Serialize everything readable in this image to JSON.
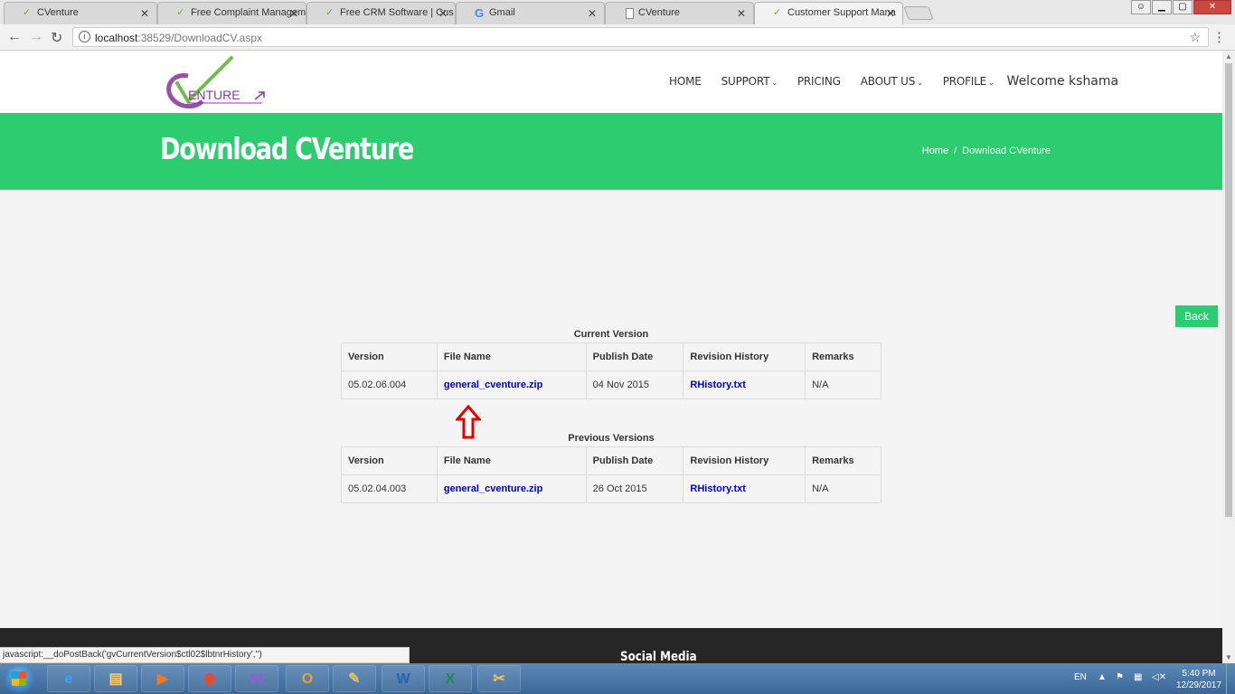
{
  "browser": {
    "tabs": [
      {
        "title": "CVenture",
        "icon": "cventure-check-icon"
      },
      {
        "title": "Free Complaint Managem",
        "icon": "cventure-check-icon"
      },
      {
        "title": "Free CRM Software | Cus",
        "icon": "cventure-check-icon"
      },
      {
        "title": "Gmail",
        "icon": "google-g-icon"
      },
      {
        "title": "CVenture",
        "icon": "page-icon"
      },
      {
        "title": "Customer Support Mana",
        "icon": "cventure-check-icon"
      }
    ],
    "url_host": "localhost",
    "url_path": ":38529/DownloadCV.aspx"
  },
  "header": {
    "logo_text": "ENTURE",
    "nav": {
      "home": "HOME",
      "support": "SUPPORT",
      "pricing": "PRICING",
      "about": "ABOUT US",
      "profile": "PROFILE",
      "welcome": "Welcome kshama"
    }
  },
  "hero": {
    "title": "Download CVenture",
    "breadcrumb_home": "Home",
    "breadcrumb_sep": "/",
    "breadcrumb_current": "Download CVenture"
  },
  "back_button": "Back",
  "current": {
    "caption": "Current Version",
    "headers": [
      "Version",
      "File Name",
      "Publish Date",
      "Revision History",
      "Remarks"
    ],
    "row": {
      "version": "05.02.06.004",
      "file": "general_cventure.zip",
      "date": "04 Nov 2015",
      "history": "RHistory.txt",
      "remarks": "N/A"
    }
  },
  "previous": {
    "caption": "Previous Versions",
    "headers": [
      "Version",
      "File Name",
      "Publish Date",
      "Revision History",
      "Remarks"
    ],
    "row": {
      "version": "05.02.04.003",
      "file": "general_cventure.zip",
      "date": "26 Oct 2015",
      "history": "RHistory.txt",
      "remarks": "N/A"
    }
  },
  "footer": {
    "social": "Social Media"
  },
  "status_text": "javascript:__doPostBack('gvCurrentVersion$ctl02$lbtnrHistory','')",
  "taskbar": {
    "lang": "EN",
    "time": "5:40 PM",
    "date": "12/29/2017"
  },
  "colors": {
    "accent": "#2ecc71",
    "link": "#0000c8",
    "footer": "#262626",
    "annotation_arrow": "#e00000"
  }
}
